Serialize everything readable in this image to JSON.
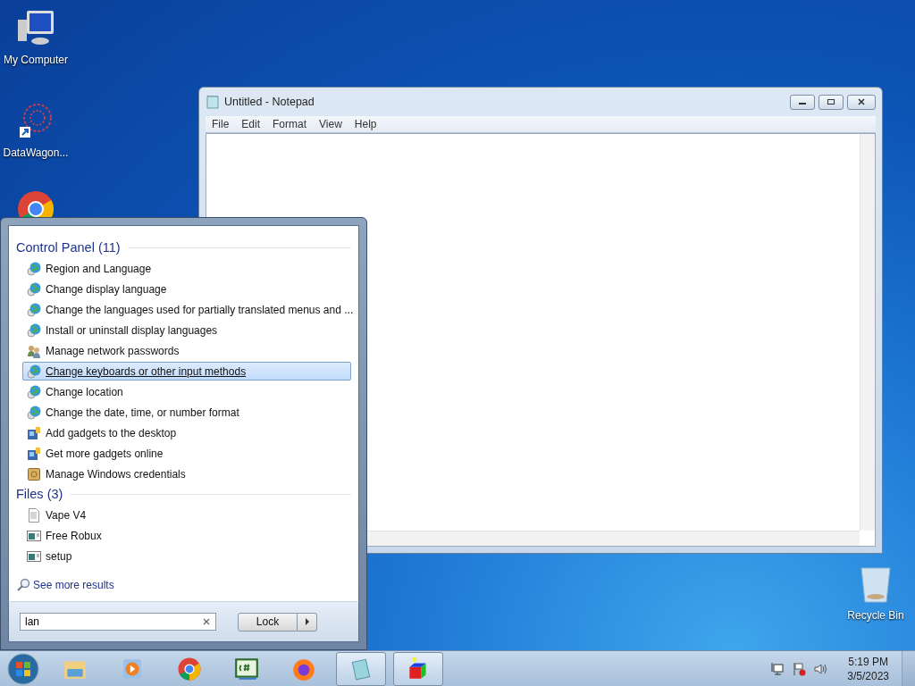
{
  "desktop_icons": [
    {
      "kind": "computer",
      "label": "My Computer"
    },
    {
      "kind": "network-shortcut",
      "label": "DataWagon..."
    },
    {
      "kind": "chrome"
    },
    {
      "kind": "recycle",
      "label": "Recycle Bin"
    }
  ],
  "notepad": {
    "title": "Untitled - Notepad",
    "menu": [
      "File",
      "Edit",
      "Format",
      "View",
      "Help"
    ]
  },
  "start_menu": {
    "groups": [
      {
        "title": "Control Panel (11)",
        "items": [
          {
            "kind": "globe",
            "label": "Region and Language",
            "selected": false
          },
          {
            "kind": "globe",
            "label": "Change display language",
            "selected": false
          },
          {
            "kind": "globe",
            "label": "Change the languages used for partially translated menus and ...",
            "selected": false
          },
          {
            "kind": "globe",
            "label": "Install or uninstall display languages",
            "selected": false
          },
          {
            "kind": "users",
            "label": "Manage network passwords",
            "selected": false
          },
          {
            "kind": "globe",
            "label": "Change keyboards or other input methods",
            "selected": true
          },
          {
            "kind": "globe",
            "label": "Change location",
            "selected": false
          },
          {
            "kind": "globe",
            "label": "Change the date, time, or number format",
            "selected": false
          },
          {
            "kind": "gadget",
            "label": "Add gadgets to the desktop",
            "selected": false
          },
          {
            "kind": "gadget",
            "label": "Get more gadgets online",
            "selected": false
          },
          {
            "kind": "vault",
            "label": "Manage Windows credentials",
            "selected": false
          }
        ]
      },
      {
        "title": "Files (3)",
        "items": [
          {
            "kind": "text-file",
            "label": "Vape V4",
            "selected": false
          },
          {
            "kind": "program",
            "label": "Free Robux",
            "selected": false
          },
          {
            "kind": "program",
            "label": "setup",
            "selected": false
          }
        ]
      }
    ],
    "see_more": "See more results",
    "search": {
      "value": "lan"
    },
    "power_button": "Lock"
  },
  "taskbar": {
    "items": [
      {
        "kind": "explorer",
        "running": false
      },
      {
        "kind": "media",
        "running": false
      },
      {
        "kind": "chrome",
        "running": false
      },
      {
        "kind": "csharp",
        "running": false
      },
      {
        "kind": "firefox",
        "running": false
      },
      {
        "kind": "notepad",
        "running": true
      },
      {
        "kind": "cube",
        "running": true
      }
    ],
    "time": "5:19 PM",
    "date": "3/5/2023"
  }
}
